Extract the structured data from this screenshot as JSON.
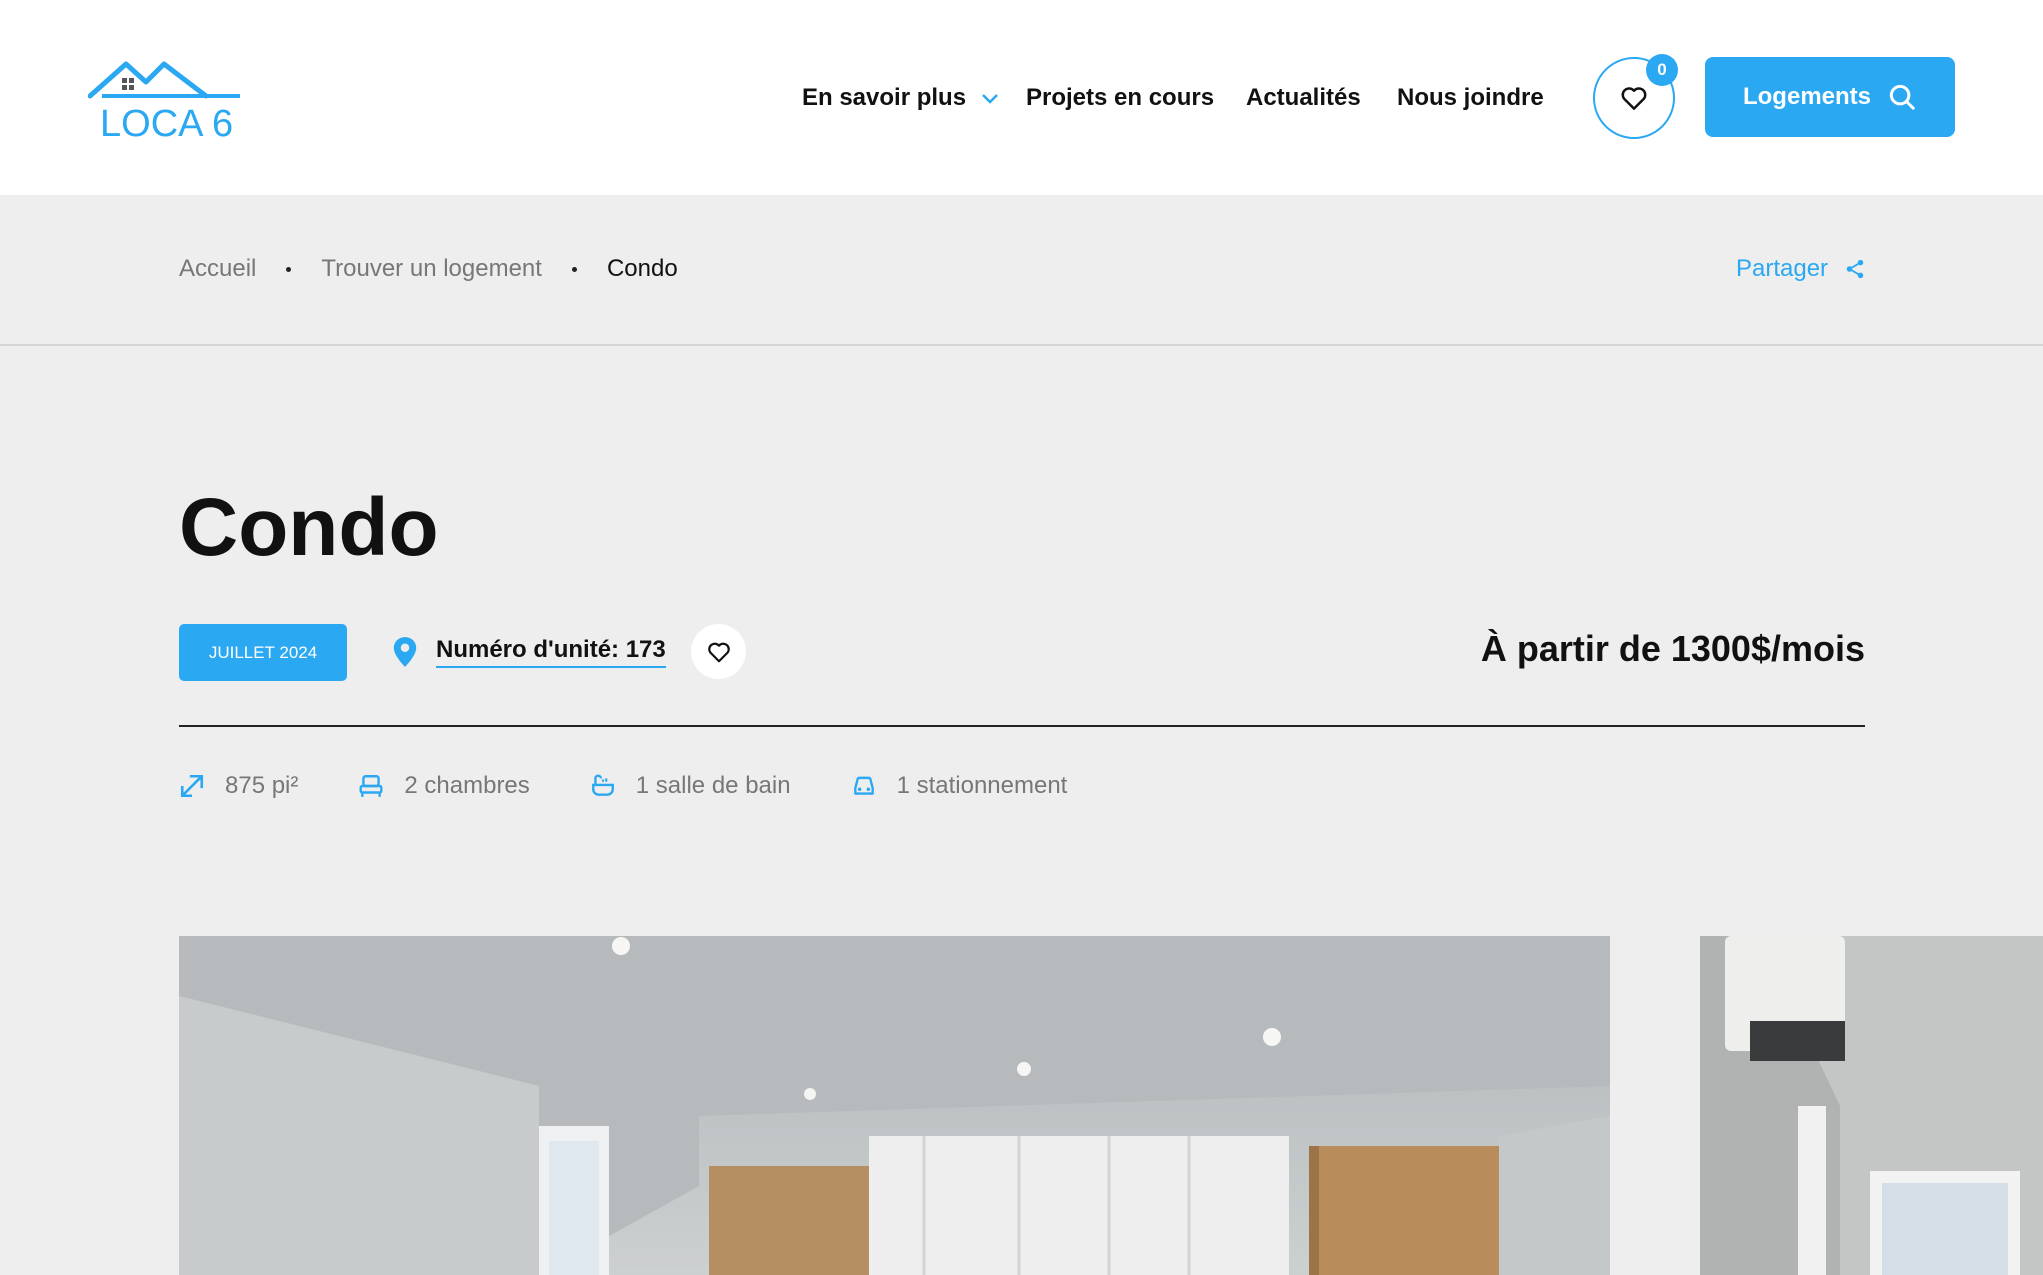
{
  "brand": {
    "logo_text": "LOCA 6",
    "accent": "#2aa8f2"
  },
  "nav": {
    "items": [
      {
        "label": "En savoir plus",
        "has_dropdown": true
      },
      {
        "label": "Projets en cours"
      },
      {
        "label": "Actualités"
      },
      {
        "label": "Nous joindre"
      }
    ],
    "favorites_count": "0",
    "logements_label": "Logements"
  },
  "breadcrumb": {
    "items": [
      "Accueil",
      "Trouver un logement",
      "Condo"
    ],
    "share_label": "Partager"
  },
  "listing": {
    "title": "Condo",
    "availability": "JUILLET 2024",
    "unit_label": "Numéro d'unité: 173",
    "price": "À partir de 1300$/mois",
    "features": [
      {
        "icon": "resize-arrow-icon",
        "label": "875 pi²"
      },
      {
        "icon": "bed-icon",
        "label": "2 chambres"
      },
      {
        "icon": "bathtub-icon",
        "label": "1 salle de bain"
      },
      {
        "icon": "car-icon",
        "label": "1 stationnement"
      }
    ]
  }
}
